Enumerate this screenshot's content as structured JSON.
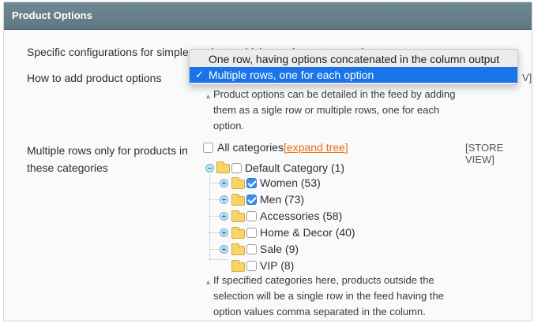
{
  "panel": {
    "title": "Product Options"
  },
  "intro": "Specific configurations for simple products which vary by custom options.",
  "add_options": {
    "label": "How to add product options",
    "dropdown_options": [
      "One row, having options concatenated in the column output",
      "Multiple rows, one for each option"
    ],
    "selected_index": 1,
    "scope_partial": "V]",
    "note_lines": [
      "Product options can be detailed in the feed by adding",
      "them as a sigle row or multiple rows, one for each",
      "option."
    ]
  },
  "categories": {
    "label_lines": [
      "Multiple rows only for products in",
      "these categories"
    ],
    "all_label": "All categories",
    "expand_link": "[expand tree]",
    "scope": "[STORE VIEW]",
    "tree": [
      {
        "label": "Default Category (1)",
        "checked": false,
        "level": 0
      },
      {
        "label": "Women (53)",
        "checked": true,
        "level": 1
      },
      {
        "label": "Men (73)",
        "checked": true,
        "level": 1
      },
      {
        "label": "Accessories (58)",
        "checked": false,
        "level": 1
      },
      {
        "label": "Home & Decor (40)",
        "checked": false,
        "level": 1
      },
      {
        "label": "Sale (9)",
        "checked": false,
        "level": 1
      },
      {
        "label": "VIP (8)",
        "checked": false,
        "level": 1
      }
    ],
    "note_lines": [
      "If specified categories here, products outside the",
      "selection will be a single row in the feed having the",
      "option values comma separated in the column."
    ]
  },
  "colors": {
    "header_bg": "#6f8992",
    "link": "#eb6b12",
    "selection": "#1a73e8"
  }
}
